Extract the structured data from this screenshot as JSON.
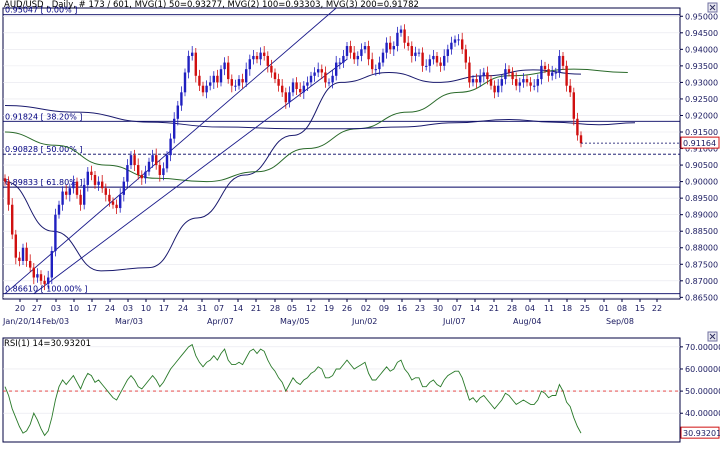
{
  "chart_data": [
    {
      "type": "candlestick",
      "header": "AUD/USD , Daily, # 173 / 601, MVG(1) 50=0.93277, MVG(2) 100=0.93303, MVG(3) 200=0.91782",
      "ylim": [
        0.8645,
        0.9525
      ],
      "yticks": [
        "0.95000",
        "0.94500",
        "0.94000",
        "0.93500",
        "0.93000",
        "0.92500",
        "0.92000",
        "0.91500",
        "0.91000",
        "0.90500",
        "0.90000",
        "0.89500",
        "0.89000",
        "0.88500",
        "0.88000",
        "0.87500",
        "0.87000",
        "0.86500"
      ],
      "day_ticks": [
        "20",
        "27",
        "03",
        "10",
        "17",
        "24",
        "03",
        "10",
        "17",
        "24",
        "31",
        "07",
        "14",
        "21",
        "28",
        "05",
        "12",
        "19",
        "26",
        "02",
        "09",
        "16",
        "23",
        "30",
        "07",
        "14",
        "21",
        "28",
        "04",
        "11",
        "18",
        "25",
        "01",
        "08",
        "15",
        "22"
      ],
      "month_ticks": [
        "Jan/20/14",
        "Feb/03",
        "Mar/03",
        "Apr/07",
        "May/05",
        "Jun/02",
        "Jul/07",
        "Aug/04",
        "Sep/08"
      ],
      "fib_levels": [
        {
          "label": "0.95047 [  0.00% ]",
          "value": 0.95047
        },
        {
          "label": "0.91824 [ 38.20% ]",
          "value": 0.91824
        },
        {
          "label": "0.90828 [ 50.00% ]",
          "value": 0.90828
        },
        {
          "label": "0.89833 [ 61.80% ]",
          "value": 0.89833
        },
        {
          "label": "0.86610 [ 100.00% ]",
          "value": 0.8661
        }
      ],
      "last_price": "0.91164",
      "last_value": 0.91164,
      "ohlc_close": [
        0.9,
        0.893,
        0.884,
        0.877,
        0.876,
        0.88,
        0.876,
        0.874,
        0.871,
        0.872,
        0.87,
        0.869,
        0.871,
        0.879,
        0.89,
        0.893,
        0.897,
        0.896,
        0.898,
        0.9,
        0.896,
        0.893,
        0.899,
        0.903,
        0.902,
        0.899,
        0.9,
        0.898,
        0.896,
        0.894,
        0.893,
        0.892,
        0.896,
        0.9,
        0.905,
        0.908,
        0.905,
        0.902,
        0.901,
        0.903,
        0.906,
        0.908,
        0.905,
        0.902,
        0.904,
        0.908,
        0.913,
        0.919,
        0.923,
        0.927,
        0.933,
        0.938,
        0.939,
        0.932,
        0.929,
        0.927,
        0.929,
        0.93,
        0.932,
        0.93,
        0.934,
        0.936,
        0.931,
        0.929,
        0.929,
        0.931,
        0.93,
        0.934,
        0.937,
        0.938,
        0.937,
        0.939,
        0.938,
        0.935,
        0.933,
        0.931,
        0.929,
        0.927,
        0.924,
        0.927,
        0.93,
        0.928,
        0.927,
        0.929,
        0.93,
        0.932,
        0.933,
        0.934,
        0.933,
        0.93,
        0.93,
        0.932,
        0.936,
        0.936,
        0.938,
        0.941,
        0.939,
        0.937,
        0.938,
        0.94,
        0.941,
        0.937,
        0.934,
        0.934,
        0.936,
        0.939,
        0.942,
        0.94,
        0.941,
        0.945,
        0.946,
        0.942,
        0.941,
        0.938,
        0.939,
        0.939,
        0.935,
        0.935,
        0.937,
        0.938,
        0.936,
        0.935,
        0.938,
        0.94,
        0.942,
        0.943,
        0.943,
        0.94,
        0.936,
        0.93,
        0.931,
        0.93,
        0.932,
        0.933,
        0.931,
        0.929,
        0.927,
        0.929,
        0.931,
        0.934,
        0.933,
        0.931,
        0.929,
        0.93,
        0.931,
        0.93,
        0.929,
        0.929,
        0.931,
        0.935,
        0.934,
        0.932,
        0.933,
        0.933,
        0.938,
        0.935,
        0.929,
        0.927,
        0.919,
        0.914,
        0.9116
      ],
      "ma_50": [
        0.9,
        0.885,
        0.873,
        0.874,
        0.889,
        0.902,
        0.914,
        0.93,
        0.933,
        0.93,
        0.932,
        0.9338,
        0.9325
      ],
      "ma_100": [
        0.915,
        0.911,
        0.905,
        0.901,
        0.9,
        0.903,
        0.91,
        0.916,
        0.921,
        0.927,
        0.932,
        0.934,
        0.933
      ],
      "ma_200": [
        0.923,
        0.921,
        0.918,
        0.9165,
        0.916,
        0.916,
        0.9165,
        0.9178,
        0.9188,
        0.918,
        0.9172,
        0.9178
      ],
      "ma_100_grid": [
        0,
        14,
        28,
        42,
        56,
        70,
        84,
        98,
        112,
        126,
        140,
        158,
        173
      ],
      "ma_200_grid": [
        0,
        20,
        40,
        60,
        80,
        95,
        110,
        125,
        140,
        152,
        165,
        175
      ],
      "trendlines": [
        {
          "from": [
            0,
            0.8661
          ],
          "to": [
            92,
            0.9525
          ]
        },
        {
          "from": [
            8,
            0.8661
          ],
          "to": [
            95,
            0.937
          ]
        }
      ]
    },
    {
      "type": "line",
      "header": "RSI(1) 14=30.93201",
      "ylim": [
        27,
        74
      ],
      "yticks": [
        "70.00000",
        "60.00000",
        "50.00000",
        "40.00000"
      ],
      "reference": 50,
      "last_label": "30.93201",
      "values": [
        52,
        48,
        42,
        38,
        34,
        31,
        32,
        35,
        40,
        37,
        33,
        30,
        32,
        38,
        46,
        52,
        55,
        53,
        55,
        57,
        54,
        51,
        55,
        58,
        57,
        54,
        55,
        53,
        51,
        49,
        47,
        46,
        49,
        52,
        55,
        57,
        55,
        52,
        51,
        53,
        55,
        57,
        55,
        52,
        54,
        57,
        60,
        62,
        64,
        66,
        68,
        70,
        71,
        66,
        63,
        61,
        63,
        64,
        66,
        64,
        67,
        69,
        64,
        62,
        62,
        63,
        62,
        65,
        68,
        69,
        67,
        69,
        68,
        64,
        61,
        59,
        56,
        54,
        50,
        53,
        56,
        54,
        53,
        55,
        56,
        58,
        59,
        61,
        60,
        56,
        56,
        57,
        60,
        60,
        62,
        64,
        62,
        60,
        61,
        62,
        63,
        58,
        55,
        55,
        57,
        59,
        61,
        59,
        60,
        63,
        64,
        60,
        58,
        55,
        56,
        56,
        52,
        52,
        54,
        55,
        53,
        52,
        55,
        57,
        58,
        59,
        59,
        56,
        51,
        46,
        47,
        45,
        47,
        48,
        46,
        44,
        42,
        44,
        46,
        49,
        48,
        46,
        44,
        45,
        46,
        45,
        44,
        44,
        46,
        50,
        49,
        47,
        48,
        48,
        53,
        50,
        45,
        43,
        38,
        34,
        31
      ]
    }
  ]
}
